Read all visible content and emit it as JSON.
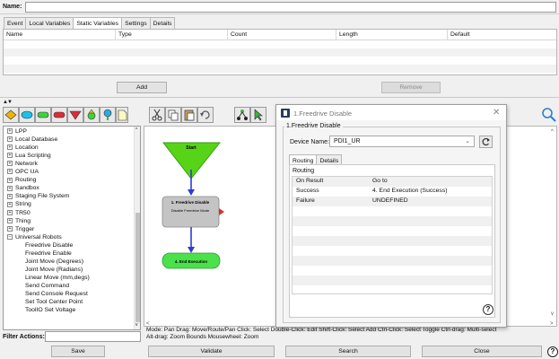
{
  "name_field": {
    "label": "Name:",
    "value": ""
  },
  "var_tabs": [
    "Event",
    "Local Variables",
    "Static Variables",
    "Settings",
    "Details"
  ],
  "var_table": {
    "columns": [
      "Name",
      "Type",
      "Count",
      "Length",
      "Default"
    ]
  },
  "var_buttons": {
    "add": "Add",
    "remove": "Remove"
  },
  "tree": {
    "groups": [
      "LPP",
      "Local Database",
      "Location",
      "Lua Scripting",
      "Network",
      "OPC UA",
      "Routing",
      "Sandbox",
      "Staging File System",
      "String",
      "TR50",
      "Thing",
      "Trigger",
      "Universal Robots"
    ],
    "expanded_group": "Universal Robots",
    "leaves": [
      "Freedrive Disable",
      "Freedrive Enable",
      "Joint Move (Degrees)",
      "Joint Move (Radians)",
      "Linear Move (mm,degs)",
      "Send Command",
      "Send Console Request",
      "Set Tool Center Point",
      "ToolIO Set Voltage"
    ]
  },
  "filter": {
    "label": "Filter Actions:",
    "value": ""
  },
  "flow": {
    "start": "Start",
    "step1_title": "1. Freedrive Disable",
    "step1_sub": "Disable Freedrive Mode",
    "step4": "4. End Execution"
  },
  "help_text": {
    "line1": "Mode: Pan  Drag: Move/Route/Pan  Click: Select  Double-Click: Edit  Shift-Click: Select Add  Ctrl-Click: Select Toggle  Ctrl-drag: Multi-select",
    "line2": "Alt-drag: Zoom Bounds  Mousewheel: Zoom"
  },
  "dialog": {
    "title": "1.Freedrive Disable",
    "group_label": "1.Freedrive Disable",
    "device_label": "Device Name:",
    "device_value": "PDI1_UR",
    "tabs": [
      "Routing",
      "Details"
    ],
    "routing_label": "Routing",
    "columns": [
      "On Result",
      "Go to"
    ],
    "rows": [
      {
        "result": "Success",
        "goto": "4. End Execution (Success)"
      },
      {
        "result": "Failure",
        "goto": "UNDEFINED"
      }
    ],
    "help": "?"
  },
  "bottom_buttons": {
    "save": "Save",
    "validate": "Validate",
    "search": "Search",
    "close": "Close",
    "help": "?"
  },
  "colors": {
    "start": "#57d417",
    "step": "#c4c4c4",
    "end": "#4ae14a",
    "arrow": "#2f3ad6",
    "error_arrow": "#e02a2a"
  }
}
